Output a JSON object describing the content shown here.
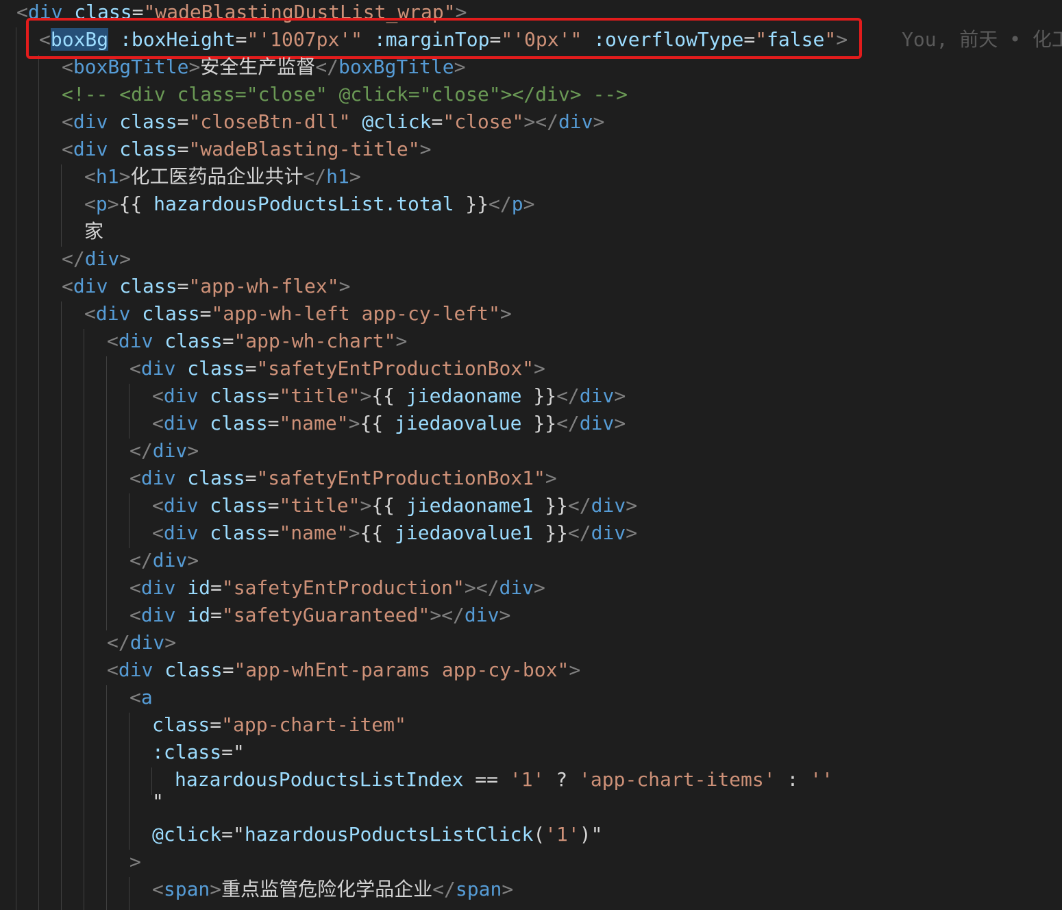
{
  "window": {
    "title": "code editor"
  },
  "blame": {
    "text": "You, 前天 • 化工"
  },
  "code": {
    "l0": {
      "t1": "<",
      "tag": "div",
      "sp": " ",
      "attr": "class",
      "eq": "=",
      "val": "\"wadeBlastingDustList_wrap\"",
      "t2": ">"
    },
    "l1": {
      "t1": "<",
      "tag": "boxBg",
      "sp1": " ",
      "a1": ":boxHeight",
      "eq1": "=",
      "q1": "\"",
      "v1": "'1007px'",
      "q2": "\"",
      "sp2": " ",
      "a2": ":marginTop",
      "eq2": "=",
      "q3": "\"",
      "v2": "'0px'",
      "q4": "\"",
      "sp3": " ",
      "a3": ":overflowType",
      "eq3": "=",
      "q5": "\"",
      "v3": "false",
      "q6": "\"",
      "t2": ">"
    },
    "l2": {
      "t1": "<",
      "tag": "boxBgTitle",
      "t2": ">",
      "text": "安全生产监督",
      "t3": "</",
      "tag2": "boxBgTitle",
      "t4": ">"
    },
    "l3": {
      "comment": "<!-- <div class=\"close\" @click=\"close\"></div> -->"
    },
    "l4": {
      "t1": "<",
      "tag": "div",
      "sp1": " ",
      "a1": "class",
      "eq1": "=",
      "v1": "\"closeBtn-dll\"",
      "sp2": " ",
      "a2": "@click",
      "eq2": "=",
      "v2": "\"close\"",
      "t2": "></",
      "tag2": "div",
      "t3": ">"
    },
    "l5": {
      "t1": "<",
      "tag": "div",
      "sp1": " ",
      "a1": "class",
      "eq1": "=",
      "v1": "\"wadeBlasting-title\"",
      "t2": ">"
    },
    "l6": {
      "t1": "<",
      "tag": "h1",
      "t2": ">",
      "text": "化工医药品企业共计",
      "t3": "</",
      "tag2": "h1",
      "t4": ">"
    },
    "l7": {
      "t1": "<",
      "tag": "p",
      "t2": ">",
      "o": "{{ ",
      "expr": "hazardousPoductsList.total",
      "c": " }}",
      "t3": "</",
      "tag2": "p",
      "t4": ">"
    },
    "l8": {
      "text": "家"
    },
    "l9": {
      "t1": "</",
      "tag": "div",
      "t2": ">"
    },
    "l10": {
      "t1": "<",
      "tag": "div",
      "sp1": " ",
      "a1": "class",
      "eq1": "=",
      "v1": "\"app-wh-flex\"",
      "t2": ">"
    },
    "l11": {
      "t1": "<",
      "tag": "div",
      "sp1": " ",
      "a1": "class",
      "eq1": "=",
      "v1": "\"app-wh-left app-cy-left\"",
      "t2": ">"
    },
    "l12": {
      "t1": "<",
      "tag": "div",
      "sp1": " ",
      "a1": "class",
      "eq1": "=",
      "v1": "\"app-wh-chart\"",
      "t2": ">"
    },
    "l13": {
      "t1": "<",
      "tag": "div",
      "sp1": " ",
      "a1": "class",
      "eq1": "=",
      "v1": "\"safetyEntProductionBox\"",
      "t2": ">"
    },
    "l14": {
      "t1": "<",
      "tag": "div",
      "sp1": " ",
      "a1": "class",
      "eq1": "=",
      "v1": "\"title\"",
      "t2": ">",
      "o": "{{ ",
      "expr": "jiedaoname",
      "c": " }}",
      "t3": "</",
      "tag2": "div",
      "t4": ">"
    },
    "l15": {
      "t1": "<",
      "tag": "div",
      "sp1": " ",
      "a1": "class",
      "eq1": "=",
      "v1": "\"name\"",
      "t2": ">",
      "o": "{{ ",
      "expr": "jiedaovalue",
      "c": " }}",
      "t3": "</",
      "tag2": "div",
      "t4": ">"
    },
    "l16": {
      "t1": "</",
      "tag": "div",
      "t2": ">"
    },
    "l17": {
      "t1": "<",
      "tag": "div",
      "sp1": " ",
      "a1": "class",
      "eq1": "=",
      "v1": "\"safetyEntProductionBox1\"",
      "t2": ">"
    },
    "l18": {
      "t1": "<",
      "tag": "div",
      "sp1": " ",
      "a1": "class",
      "eq1": "=",
      "v1": "\"title\"",
      "t2": ">",
      "o": "{{ ",
      "expr": "jiedaoname1",
      "c": " }}",
      "t3": "</",
      "tag2": "div",
      "t4": ">"
    },
    "l19": {
      "t1": "<",
      "tag": "div",
      "sp1": " ",
      "a1": "class",
      "eq1": "=",
      "v1": "\"name\"",
      "t2": ">",
      "o": "{{ ",
      "expr": "jiedaovalue1",
      "c": " }}",
      "t3": "</",
      "tag2": "div",
      "t4": ">"
    },
    "l20": {
      "t1": "</",
      "tag": "div",
      "t2": ">"
    },
    "l21": {
      "t1": "<",
      "tag": "div",
      "sp1": " ",
      "a1": "id",
      "eq1": "=",
      "v1": "\"safetyEntProduction\"",
      "t2": "></",
      "tag2": "div",
      "t3": ">"
    },
    "l22": {
      "t1": "<",
      "tag": "div",
      "sp1": " ",
      "a1": "id",
      "eq1": "=",
      "v1": "\"safetyGuaranteed\"",
      "t2": "></",
      "tag2": "div",
      "t3": ">"
    },
    "l23": {
      "t1": "</",
      "tag": "div",
      "t2": ">"
    },
    "l24": {
      "t1": "<",
      "tag": "div",
      "sp1": " ",
      "a1": "class",
      "eq1": "=",
      "v1": "\"app-whEnt-params app-cy-box\"",
      "t2": ">"
    },
    "l25": {
      "t1": "<",
      "tag": "a"
    },
    "l26": {
      "a1": "class",
      "eq1": "=",
      "v1": "\"app-chart-item\""
    },
    "l27": {
      "a1": ":class",
      "eq1": "=",
      "q": "\""
    },
    "l28": {
      "expr": "hazardousPoductsListIndex",
      "op1": " == ",
      "s1": "'1'",
      "op2": " ? ",
      "s2": "'app-chart-items'",
      "op3": " : ",
      "s3": "''"
    },
    "l29": {
      "q": "\""
    },
    "l30": {
      "a1": "@click",
      "eq1": "=",
      "q1": "\"",
      "fn": "hazardousPoductsListClick",
      "p1": "(",
      "s1": "'1'",
      "p2": ")",
      "q2": "\""
    },
    "l31": {
      "t1": ">"
    },
    "l32": {
      "t1": "<",
      "tag": "span",
      "t2": ">",
      "text": "重点监管危险化学品企业",
      "t3": "</",
      "tag2": "span",
      "t4": ">"
    }
  }
}
